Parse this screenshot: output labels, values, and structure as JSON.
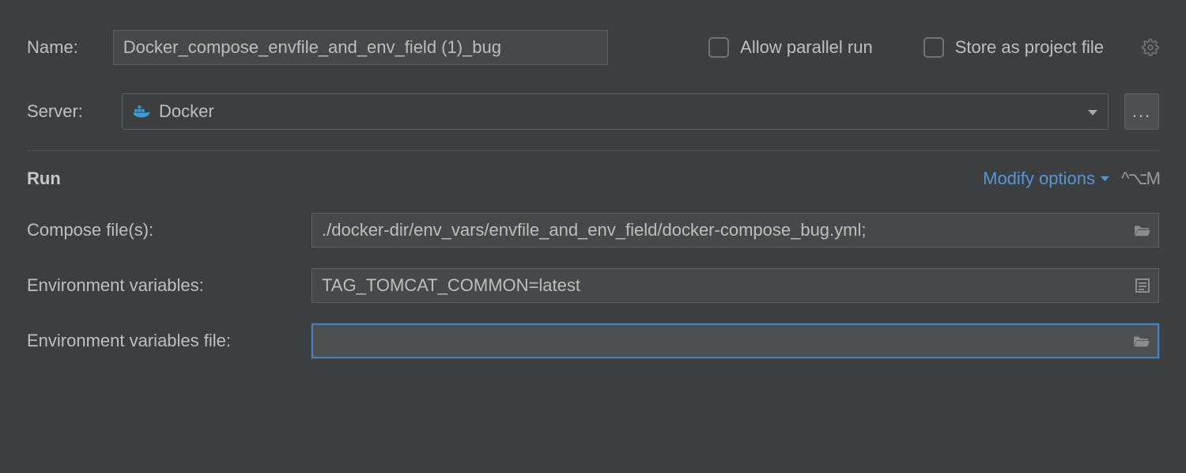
{
  "top": {
    "name_label": "Name:",
    "name_value": "Docker_compose_envfile_and_env_field (1)_bug",
    "allow_parallel_label": "Allow parallel run",
    "store_project_label": "Store as project file"
  },
  "server": {
    "label": "Server:",
    "value": "Docker",
    "ellipsis": "..."
  },
  "section": {
    "title": "Run",
    "modify_label": "Modify options",
    "shortcut": "^⌥M"
  },
  "fields": {
    "compose_label": "Compose file(s):",
    "compose_value": "./docker-dir/env_vars/envfile_and_env_field/docker-compose_bug.yml;",
    "envvars_label": "Environment variables:",
    "envvars_value": "TAG_TOMCAT_COMMON=latest",
    "envfile_label": "Environment variables file:",
    "envfile_value": ""
  }
}
